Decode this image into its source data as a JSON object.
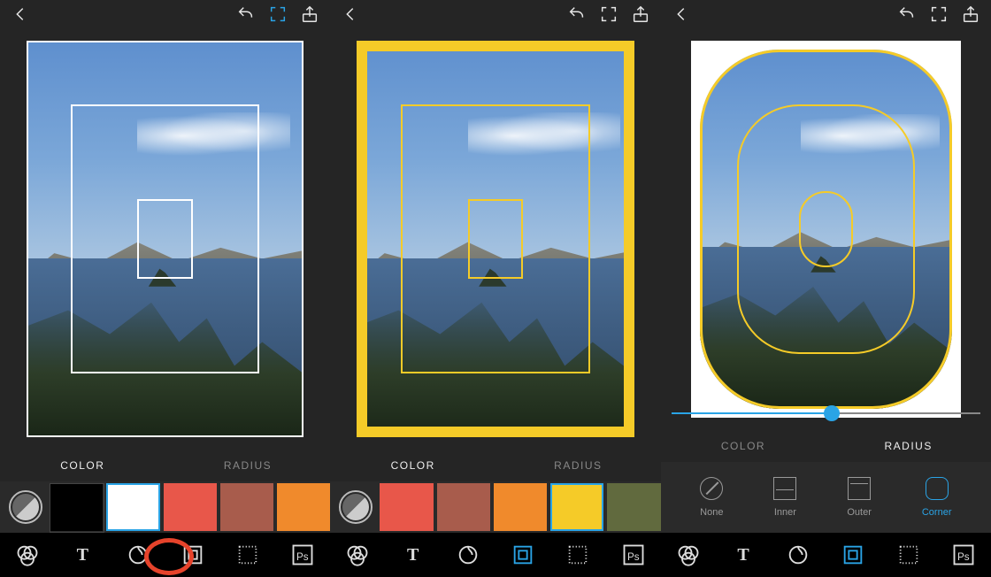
{
  "screens": [
    {
      "tabs": {
        "color": "COLOR",
        "radius": "RADIUS",
        "active": "color"
      },
      "swatches": [
        {
          "color": "#000000",
          "selected": false
        },
        {
          "color": "#ffffff",
          "selected": true
        },
        {
          "color": "#e8574a",
          "selected": false
        },
        {
          "color": "#a85c4c",
          "selected": false
        },
        {
          "color": "#f08a2c",
          "selected": false
        }
      ],
      "frame_color": "#ffffff",
      "corner_radius": 0,
      "annotation_on_border_tool": true
    },
    {
      "tabs": {
        "color": "COLOR",
        "radius": "RADIUS",
        "active": "color"
      },
      "swatches": [
        {
          "color": "#e8574a",
          "selected": false
        },
        {
          "color": "#a85c4c",
          "selected": false
        },
        {
          "color": "#f08a2c",
          "selected": false
        },
        {
          "color": "#f5cb28",
          "selected": true
        },
        {
          "color": "#616a3e",
          "selected": false
        }
      ],
      "frame_color": "#f5cb28",
      "corner_radius": 0,
      "annotation_on_border_tool": false
    },
    {
      "tabs": {
        "color": "COLOR",
        "radius": "RADIUS",
        "active": "radius"
      },
      "radius_options": [
        {
          "key": "none",
          "label": "None"
        },
        {
          "key": "inner",
          "label": "Inner"
        },
        {
          "key": "outer",
          "label": "Outer"
        },
        {
          "key": "corner",
          "label": "Corner"
        }
      ],
      "radius_selected": "corner",
      "slider_value_pct": 52,
      "frame_color": "#f5cb28",
      "outer_fill": "#ffffff",
      "corner_radius": 90,
      "annotation_on_border_tool": false
    }
  ],
  "toolbar_tools": [
    "filters",
    "text",
    "brush",
    "border",
    "pattern",
    "photoshop"
  ]
}
